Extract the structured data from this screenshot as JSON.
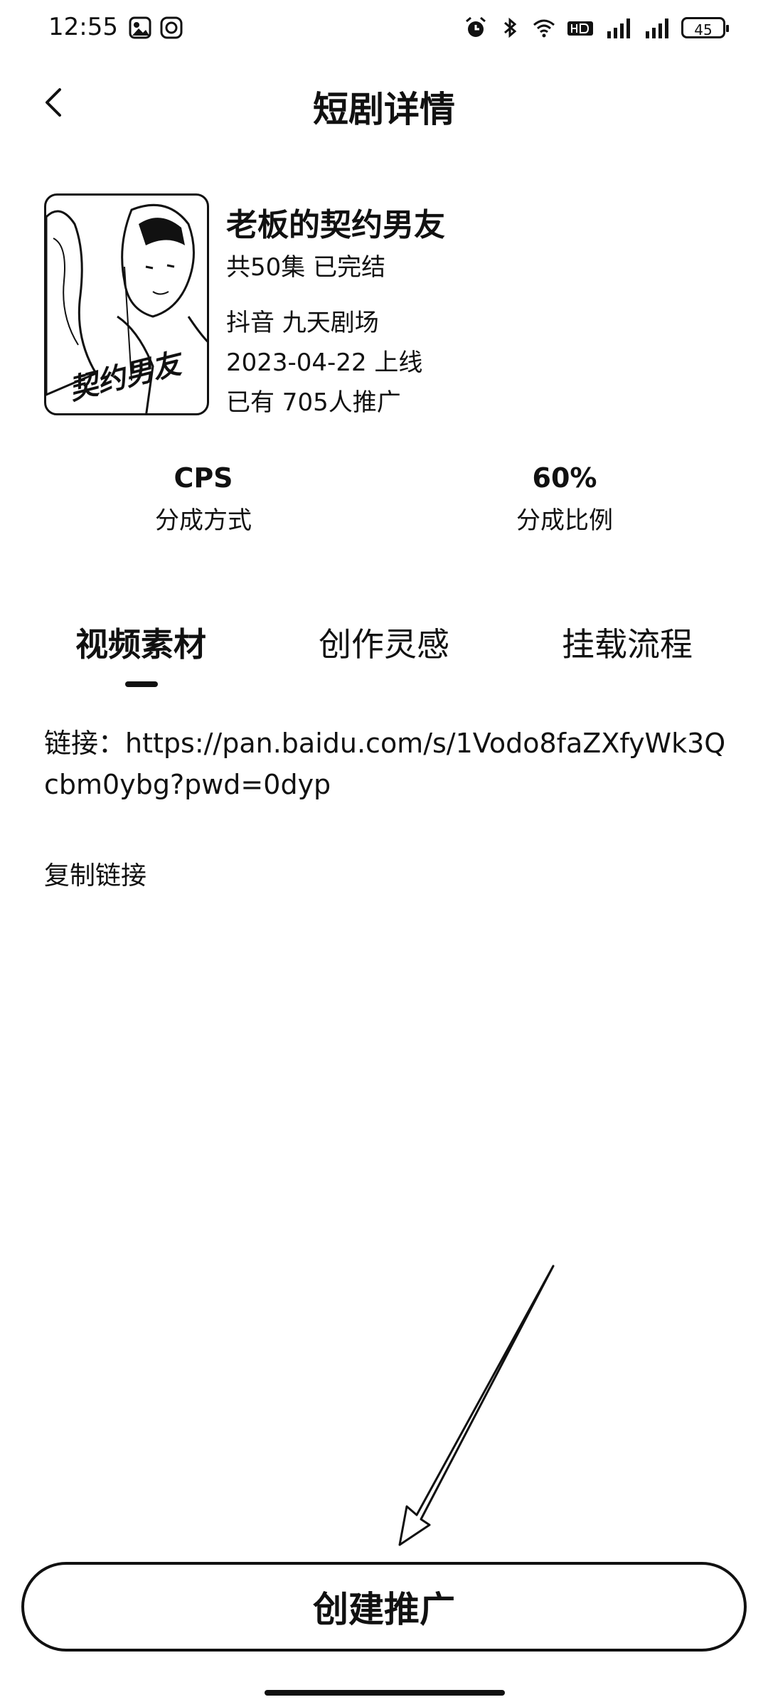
{
  "status_bar": {
    "time": "12:55",
    "battery": "45",
    "left_icons": [
      "gallery-icon",
      "browser-icon"
    ],
    "right_icons": [
      "alarm-icon",
      "bluetooth-icon",
      "wifi-icon",
      "hd-icon",
      "signal-4g-icon",
      "signal-4g-icon",
      "battery-icon"
    ]
  },
  "nav": {
    "title": "短剧详情",
    "back_icon": "chevron-left-icon"
  },
  "drama": {
    "title": "老板的契约男友",
    "episodes": "共50集 已完结",
    "platform": "抖音 九天剧场",
    "release": "2023-04-22 上线",
    "promoters": "已有 705人推广",
    "cover_text": "契约男友"
  },
  "stats": [
    {
      "value": "CPS",
      "label": "分成方式"
    },
    {
      "value": "60%",
      "label": "分成比例"
    }
  ],
  "tabs": [
    {
      "label": "视频素材",
      "active": true
    },
    {
      "label": "创作灵感",
      "active": false
    },
    {
      "label": "挂载流程",
      "active": false
    }
  ],
  "content": {
    "link_label": "链接：",
    "link_url": "https://pan.baidu.com/s/1Vodo8faZXfyWk3Qcbm0ybg?pwd=0dyp",
    "copy_label": "复制链接"
  },
  "footer": {
    "create_button": "创建推广"
  }
}
